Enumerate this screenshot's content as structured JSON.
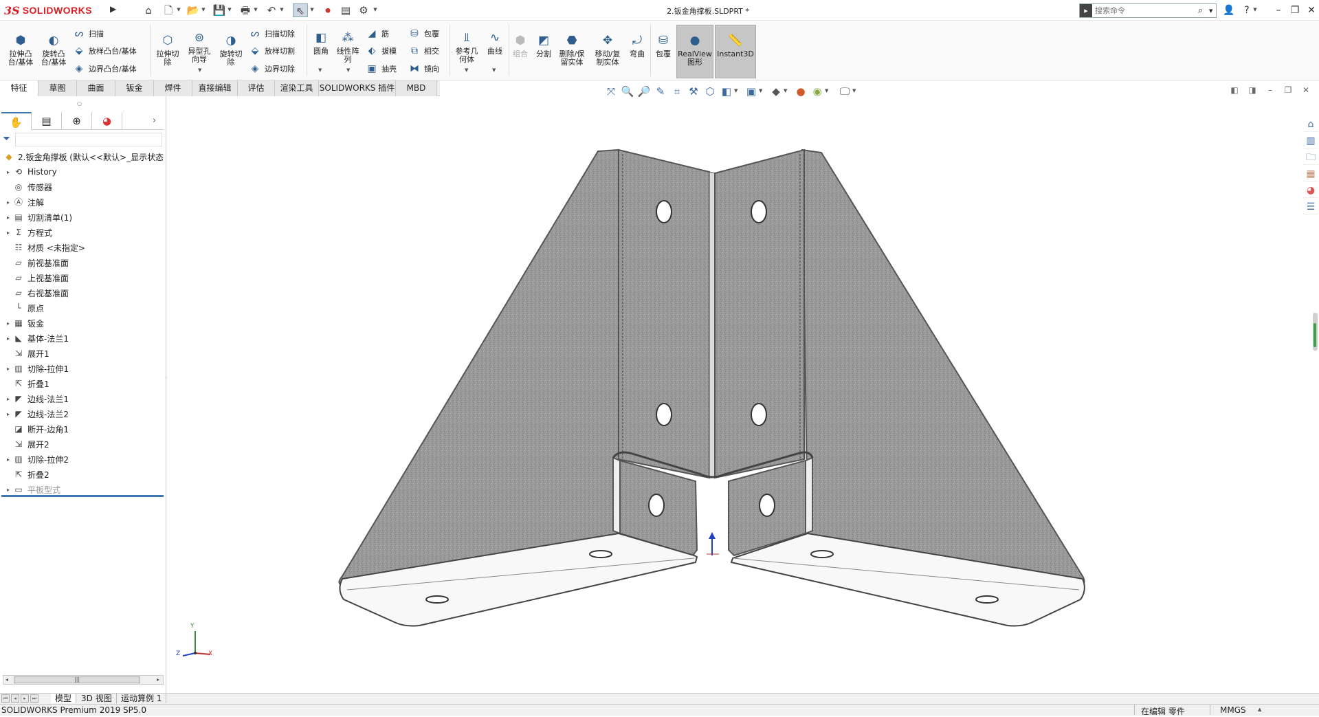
{
  "app": {
    "logo_prefix": "3S",
    "logo_text": "SOLIDWORKS",
    "document_title": "2.钣金角撑板.SLDPRT *"
  },
  "search": {
    "placeholder": "搜索命令"
  },
  "ribbon": {
    "extrude_boss": "拉伸凸\n台/基体",
    "revolve_boss": "旋转凸\n台/基体",
    "sweep": "扫描",
    "loft_boss": "放样凸台/基体",
    "boundary_boss": "边界凸台/基体",
    "extrude_cut": "拉伸切\n除",
    "hole_wizard": "异型孔\n向导",
    "revolve_cut": "旋转切\n除",
    "swept_cut": "扫描切除",
    "lofted_cut": "放样切割",
    "boundary_cut": "边界切除",
    "fillet": "圆角",
    "linear_pattern": "线性阵\n列",
    "rib": "筋",
    "draft": "拔模",
    "shell": "抽壳",
    "wrap": "包覆",
    "intersect": "相交",
    "mirror": "镜向",
    "ref_geometry": "参考几\n何体",
    "curves": "曲线",
    "combine": "组合",
    "split": "分割",
    "delete_keep": "删除/保\n留实体",
    "move_copy": "移动/复\n制实体",
    "flex": "弯曲",
    "wrap2": "包覆",
    "realview": "RealView\n图形",
    "instant3d": "Instant3D"
  },
  "tabs": [
    "特征",
    "草图",
    "曲面",
    "钣金",
    "焊件",
    "直接编辑",
    "评估",
    "渲染工具",
    "SOLIDWORKS 插件",
    "MBD"
  ],
  "tree": {
    "root": "2.钣金角撑板 (默认<<默认>_显示状态",
    "items": [
      {
        "label": "History",
        "icon": "history-icon",
        "exp": true
      },
      {
        "label": "传感器",
        "icon": "sensor-icon",
        "exp": false
      },
      {
        "label": "注解",
        "icon": "annotation-icon",
        "exp": true
      },
      {
        "label": "切割清单(1)",
        "icon": "cut-list-icon",
        "exp": true
      },
      {
        "label": "方程式",
        "icon": "equation-icon",
        "exp": true
      },
      {
        "label": "材质 <未指定>",
        "icon": "material-icon",
        "exp": false
      },
      {
        "label": "前视基准面",
        "icon": "plane-icon",
        "exp": false
      },
      {
        "label": "上视基准面",
        "icon": "plane-icon",
        "exp": false
      },
      {
        "label": "右视基准面",
        "icon": "plane-icon",
        "exp": false
      },
      {
        "label": "原点",
        "icon": "origin-icon",
        "exp": false
      },
      {
        "label": "钣金",
        "icon": "sheet-metal-icon",
        "exp": true
      },
      {
        "label": "基体-法兰1",
        "icon": "base-flange-icon",
        "exp": true
      },
      {
        "label": "展开1",
        "icon": "unfold-icon",
        "exp": false
      },
      {
        "label": "切除-拉伸1",
        "icon": "cut-extrude-icon",
        "exp": true
      },
      {
        "label": "折叠1",
        "icon": "fold-icon",
        "exp": false
      },
      {
        "label": "边线-法兰1",
        "icon": "edge-flange-icon",
        "exp": true
      },
      {
        "label": "边线-法兰2",
        "icon": "edge-flange-icon",
        "exp": true
      },
      {
        "label": "断开-边角1",
        "icon": "break-corner-icon",
        "exp": false
      },
      {
        "label": "展开2",
        "icon": "unfold-icon",
        "exp": false
      },
      {
        "label": "切除-拉伸2",
        "icon": "cut-extrude-icon",
        "exp": true
      },
      {
        "label": "折叠2",
        "icon": "fold-icon",
        "exp": false
      },
      {
        "label": "平板型式",
        "icon": "flat-pattern-icon",
        "exp": true,
        "dim": true
      }
    ]
  },
  "bottom_tabs": [
    "模型",
    "3D 视图",
    "运动算例 1"
  ],
  "status": {
    "app": "SOLIDWORKS Premium 2019 SP5.0",
    "editing": "在编辑 零件",
    "units": "MMGS"
  },
  "triad": {
    "x": "X",
    "y": "Y",
    "z": "Z"
  },
  "colors": {
    "accent": "#3c78b4",
    "logo_red": "#d42027",
    "part_fill": "#9a9a9a"
  }
}
